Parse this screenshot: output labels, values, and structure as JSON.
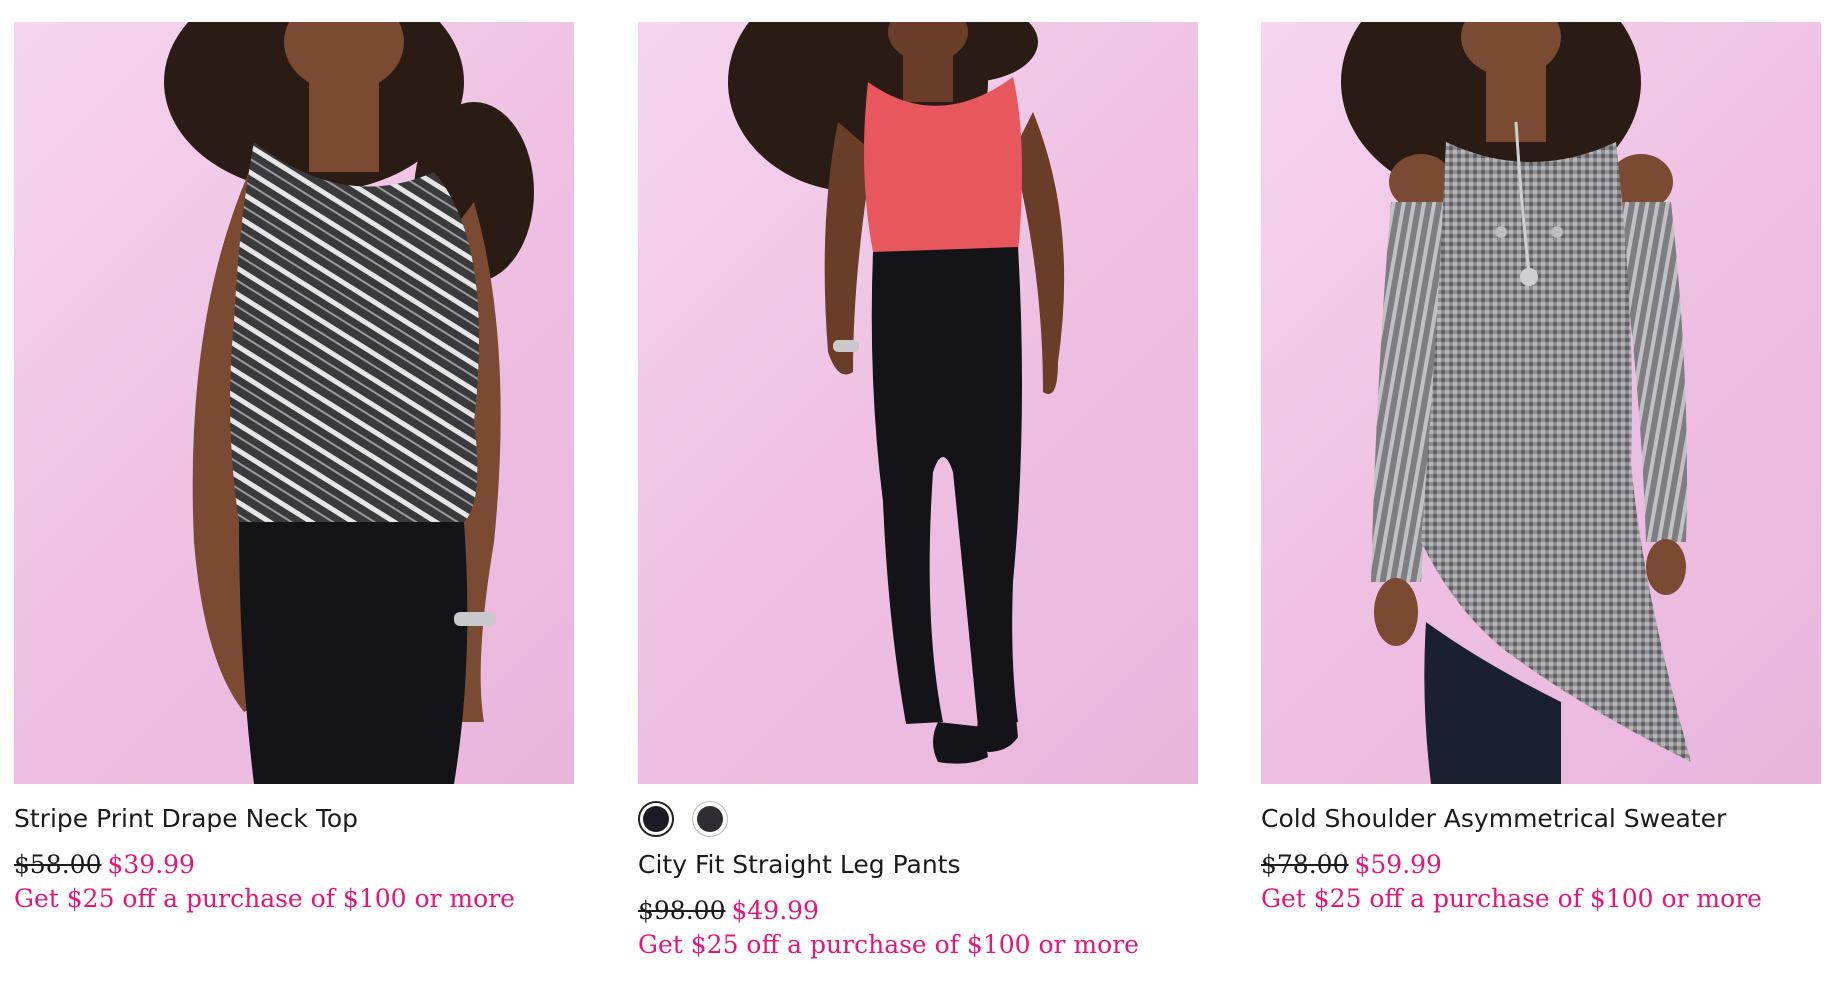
{
  "colors": {
    "background_pink": "#eec2e4",
    "sale_pink": "#e5157c",
    "text": "#1b1b1b"
  },
  "products": [
    {
      "name": "Stripe Print Drape Neck Top",
      "original_price": "$58.00",
      "sale_price": "$39.99",
      "promo": "Get $25 off a purchase of $100 or more",
      "image_icon": "model-photo-striped-top"
    },
    {
      "name": "City Fit Straight Leg Pants",
      "original_price": "$98.00",
      "sale_price": "$49.99",
      "promo": "Get $25 off a purchase of $100 or more",
      "image_icon": "model-photo-black-pants",
      "swatches": [
        {
          "color": "#1c1a22",
          "selected": true
        },
        {
          "color": "#2f2b33",
          "selected": false
        }
      ]
    },
    {
      "name": "Cold Shoulder Asymmetrical Sweater",
      "original_price": "$78.00",
      "sale_price": "$59.99",
      "promo": "Get $25 off a purchase of $100 or more",
      "image_icon": "model-photo-gray-sweater"
    }
  ]
}
